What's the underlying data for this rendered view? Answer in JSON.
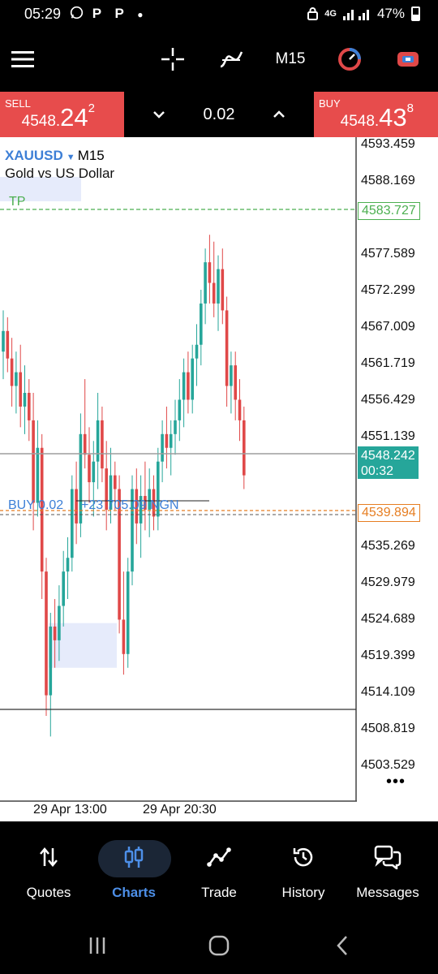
{
  "status_bar": {
    "time": "05:29",
    "left_icons": [
      "whatsapp-icon",
      "p-app-icon",
      "p-app-icon",
      "dot-icon"
    ],
    "notification_letters": "P P",
    "network": "4G",
    "battery": "47%"
  },
  "toolbar": {
    "timeframe": "M15",
    "icons": [
      "menu-icon",
      "crosshair-icon",
      "indicators-icon",
      "timeframe",
      "trade-signal-icon",
      "one-click-icon"
    ]
  },
  "trade_bar": {
    "sell_label": "SELL",
    "sell_price_small": "4548.",
    "sell_price_big": "24",
    "sell_price_sup": "2",
    "buy_label": "BUY",
    "buy_price_small": "4548.",
    "buy_price_big": "43",
    "buy_price_sup": "8",
    "lot": "0.02"
  },
  "chart": {
    "symbol": "XAUUSD",
    "timeframe": "M15",
    "description": "Gold vs US Dollar",
    "tp_label": "TP",
    "tp_price": "4583.727",
    "bid_price": "4548.242",
    "bar_timer": "00:32",
    "open_price": "4539.894",
    "position_label": "BUY 0.02",
    "position_profit": "+23 705.09 NGN",
    "price_ticks": [
      "4593.459",
      "4588.169",
      "4577.589",
      "4572.299",
      "4567.009",
      "4561.719",
      "4556.429",
      "4551.139",
      "4535.269",
      "4529.979",
      "4524.689",
      "4519.399",
      "4514.109",
      "4508.819",
      "4503.529"
    ],
    "time_labels": [
      "29 Apr 13:00",
      "29 Apr 20:30"
    ],
    "colors": {
      "bull": "#26a69a",
      "bear": "#e04848",
      "tp": "#4caf50",
      "open": "#e67e22"
    }
  },
  "chart_data": {
    "type": "candlestick",
    "symbol": "XAUUSD",
    "timeframe": "M15",
    "y_range": [
      4500.6,
      4597.2
    ],
    "candles": [
      {
        "o": 4566,
        "h": 4572,
        "l": 4562,
        "c": 4569
      },
      {
        "o": 4569,
        "h": 4571,
        "l": 4563,
        "c": 4565
      },
      {
        "o": 4565,
        "h": 4568,
        "l": 4558,
        "c": 4561
      },
      {
        "o": 4561,
        "h": 4566,
        "l": 4557,
        "c": 4563
      },
      {
        "o": 4563,
        "h": 4567,
        "l": 4555,
        "c": 4558
      },
      {
        "o": 4558,
        "h": 4564,
        "l": 4554,
        "c": 4560
      },
      {
        "o": 4560,
        "h": 4562,
        "l": 4553,
        "c": 4556
      },
      {
        "o": 4556,
        "h": 4560,
        "l": 4540,
        "c": 4544
      },
      {
        "o": 4544,
        "h": 4556,
        "l": 4542,
        "c": 4552
      },
      {
        "o": 4552,
        "h": 4554,
        "l": 4530,
        "c": 4534
      },
      {
        "o": 4534,
        "h": 4536,
        "l": 4513,
        "c": 4516
      },
      {
        "o": 4516,
        "h": 4528,
        "l": 4510,
        "c": 4526
      },
      {
        "o": 4526,
        "h": 4530,
        "l": 4520,
        "c": 4524
      },
      {
        "o": 4524,
        "h": 4532,
        "l": 4521,
        "c": 4529
      },
      {
        "o": 4529,
        "h": 4537,
        "l": 4526,
        "c": 4534
      },
      {
        "o": 4534,
        "h": 4539,
        "l": 4530,
        "c": 4536
      },
      {
        "o": 4536,
        "h": 4548,
        "l": 4534,
        "c": 4546
      },
      {
        "o": 4546,
        "h": 4550,
        "l": 4538,
        "c": 4541
      },
      {
        "o": 4541,
        "h": 4557,
        "l": 4539,
        "c": 4554
      },
      {
        "o": 4554,
        "h": 4562,
        "l": 4549,
        "c": 4551
      },
      {
        "o": 4551,
        "h": 4555,
        "l": 4544,
        "c": 4547
      },
      {
        "o": 4547,
        "h": 4553,
        "l": 4542,
        "c": 4550
      },
      {
        "o": 4550,
        "h": 4560,
        "l": 4546,
        "c": 4556
      },
      {
        "o": 4556,
        "h": 4558,
        "l": 4547,
        "c": 4549
      },
      {
        "o": 4549,
        "h": 4553,
        "l": 4540,
        "c": 4543
      },
      {
        "o": 4543,
        "h": 4552,
        "l": 4541,
        "c": 4548
      },
      {
        "o": 4548,
        "h": 4550,
        "l": 4543,
        "c": 4546
      },
      {
        "o": 4546,
        "h": 4548,
        "l": 4525,
        "c": 4527
      },
      {
        "o": 4527,
        "h": 4534,
        "l": 4519,
        "c": 4522
      },
      {
        "o": 4522,
        "h": 4536,
        "l": 4520,
        "c": 4534
      },
      {
        "o": 4534,
        "h": 4548,
        "l": 4532,
        "c": 4546
      },
      {
        "o": 4546,
        "h": 4549,
        "l": 4538,
        "c": 4541
      },
      {
        "o": 4541,
        "h": 4548,
        "l": 4536,
        "c": 4545
      },
      {
        "o": 4545,
        "h": 4550,
        "l": 4540,
        "c": 4543
      },
      {
        "o": 4543,
        "h": 4549,
        "l": 4539,
        "c": 4546
      },
      {
        "o": 4546,
        "h": 4548,
        "l": 4540,
        "c": 4542
      },
      {
        "o": 4542,
        "h": 4552,
        "l": 4540,
        "c": 4550
      },
      {
        "o": 4550,
        "h": 4556,
        "l": 4547,
        "c": 4554
      },
      {
        "o": 4554,
        "h": 4558,
        "l": 4549,
        "c": 4552
      },
      {
        "o": 4552,
        "h": 4556,
        "l": 4548,
        "c": 4554
      },
      {
        "o": 4554,
        "h": 4559,
        "l": 4551,
        "c": 4556
      },
      {
        "o": 4556,
        "h": 4562,
        "l": 4553,
        "c": 4559
      },
      {
        "o": 4559,
        "h": 4565,
        "l": 4555,
        "c": 4563
      },
      {
        "o": 4563,
        "h": 4566,
        "l": 4557,
        "c": 4559
      },
      {
        "o": 4559,
        "h": 4567,
        "l": 4557,
        "c": 4565
      },
      {
        "o": 4565,
        "h": 4570,
        "l": 4561,
        "c": 4567
      },
      {
        "o": 4567,
        "h": 4575,
        "l": 4564,
        "c": 4573
      },
      {
        "o": 4573,
        "h": 4581,
        "l": 4570,
        "c": 4579
      },
      {
        "o": 4579,
        "h": 4583,
        "l": 4573,
        "c": 4576
      },
      {
        "o": 4576,
        "h": 4582,
        "l": 4571,
        "c": 4573
      },
      {
        "o": 4573,
        "h": 4580,
        "l": 4569,
        "c": 4578
      },
      {
        "o": 4578,
        "h": 4581,
        "l": 4570,
        "c": 4572
      },
      {
        "o": 4572,
        "h": 4574,
        "l": 4558,
        "c": 4561
      },
      {
        "o": 4561,
        "h": 4566,
        "l": 4557,
        "c": 4564
      },
      {
        "o": 4564,
        "h": 4566,
        "l": 4556,
        "c": 4559
      },
      {
        "o": 4559,
        "h": 4562,
        "l": 4553,
        "c": 4556
      },
      {
        "o": 4556,
        "h": 4558,
        "l": 4546,
        "c": 4548
      }
    ]
  },
  "bottom_nav": [
    {
      "label": "Quotes",
      "icon": "quotes-icon",
      "active": false
    },
    {
      "label": "Charts",
      "icon": "charts-icon",
      "active": true
    },
    {
      "label": "Trade",
      "icon": "trade-icon",
      "active": false
    },
    {
      "label": "History",
      "icon": "history-icon",
      "active": false
    },
    {
      "label": "Messages",
      "icon": "messages-icon",
      "active": false
    }
  ],
  "system_nav": [
    "recent-apps-icon",
    "home-icon",
    "back-icon"
  ]
}
